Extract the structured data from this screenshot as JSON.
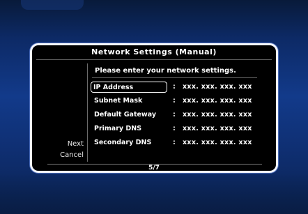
{
  "dialog": {
    "title": "Network Settings (Manual)",
    "prompt": "Please enter your network settings.",
    "page_indicator": "5/7"
  },
  "nav": {
    "next_label": "Next",
    "cancel_label": "Cancel"
  },
  "fields": [
    {
      "label": "IP Address",
      "value": "xxx. xxx. xxx. xxx",
      "selected": true
    },
    {
      "label": "Subnet Mask",
      "value": "xxx. xxx. xxx. xxx",
      "selected": false
    },
    {
      "label": "Default Gateway",
      "value": "xxx. xxx. xxx. xxx",
      "selected": false
    },
    {
      "label": "Primary DNS",
      "value": "xxx. xxx. xxx. xxx",
      "selected": false
    },
    {
      "label": "Secondary DNS",
      "value": "xxx. xxx. xxx. xxx",
      "selected": false
    }
  ],
  "separator": ":",
  "colors": {
    "panel_background": "#000000",
    "panel_border": "#f3f6ff",
    "screen_background": "#123a8a",
    "text": "#ffffff"
  }
}
